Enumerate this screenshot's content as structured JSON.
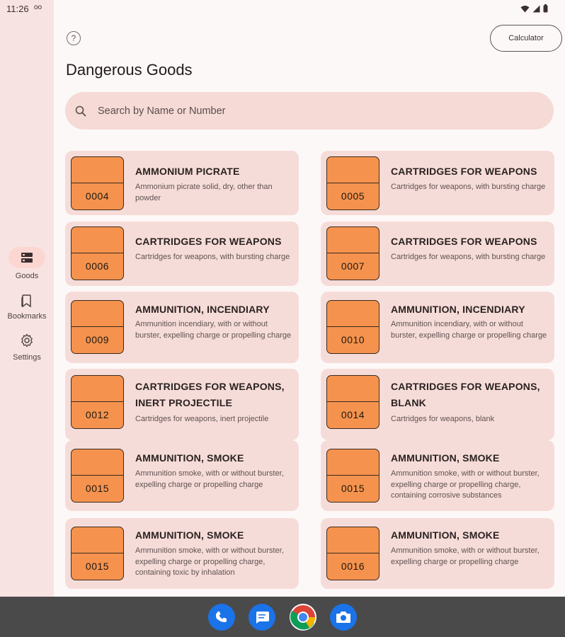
{
  "status": {
    "time": "11:26",
    "extra": "oo"
  },
  "nav": {
    "items": [
      {
        "label": "Goods",
        "icon": "goods-icon",
        "active": true
      },
      {
        "label": "Bookmarks",
        "icon": "bookmark-icon",
        "active": false
      },
      {
        "label": "Settings",
        "icon": "gear-icon",
        "active": false
      }
    ]
  },
  "header": {
    "help": "?",
    "calculator_label": "Calculator",
    "title": "Dangerous Goods"
  },
  "search": {
    "placeholder": "Search by Name or Number",
    "value": ""
  },
  "cards": [
    {
      "number": "0004",
      "title": "AMMONIUM PICRATE",
      "description": "Ammonium picrate solid, dry, other than powder"
    },
    {
      "number": "0005",
      "title": "CARTRIDGES FOR WEAPONS",
      "description": "Cartridges for weapons, with bursting charge"
    },
    {
      "number": "0006",
      "title": "CARTRIDGES FOR WEAPONS",
      "description": "Cartridges for weapons, with bursting charge"
    },
    {
      "number": "0007",
      "title": "CARTRIDGES FOR WEAPONS",
      "description": "Cartridges for weapons, with bursting charge"
    },
    {
      "number": "0009",
      "title": "AMMUNITION, INCENDIARY",
      "description": "Ammunition incendiary, with or without burster, expelling charge or propelling charge"
    },
    {
      "number": "0010",
      "title": "AMMUNITION, INCENDIARY",
      "description": "Ammunition incendiary, with or without burster, expelling charge or propelling charge"
    },
    {
      "number": "0012",
      "title": "CARTRIDGES FOR WEAPONS, INERT PROJECTILE",
      "description": "Cartridges for weapons, inert projectile"
    },
    {
      "number": "0014",
      "title": "CARTRIDGES FOR WEAPONS, BLANK",
      "description": "Cartridges for weapons, blank"
    },
    {
      "number": "0015",
      "title": "AMMUNITION, SMOKE",
      "description": "Ammunition smoke, with or without burster, expelling charge or propelling charge"
    },
    {
      "number": "0015",
      "title": "AMMUNITION, SMOKE",
      "description": "Ammunition smoke, with or without burster, expelling charge or propelling charge, containing corrosive substances"
    },
    {
      "number": "0015",
      "title": "AMMUNITION, SMOKE",
      "description": "Ammunition smoke, with or without burster, expelling charge or propelling charge, containing toxic by inhalation"
    },
    {
      "number": "0016",
      "title": "AMMUNITION, SMOKE",
      "description": "Ammunition smoke, with or without burster, expelling charge or propelling charge"
    }
  ],
  "taskbar": {
    "apps": [
      {
        "icon": "phone-icon",
        "color": "#1a73e8"
      },
      {
        "icon": "messages-icon",
        "color": "#1a73e8"
      },
      {
        "icon": "chrome-icon",
        "color": "#ffffff"
      },
      {
        "icon": "camera-icon",
        "color": "#1a73e8"
      }
    ]
  },
  "colors": {
    "badge": "#f5934e",
    "card": "#f6dcd8",
    "rail": "#f7e4e2",
    "search": "#f6dad6"
  }
}
